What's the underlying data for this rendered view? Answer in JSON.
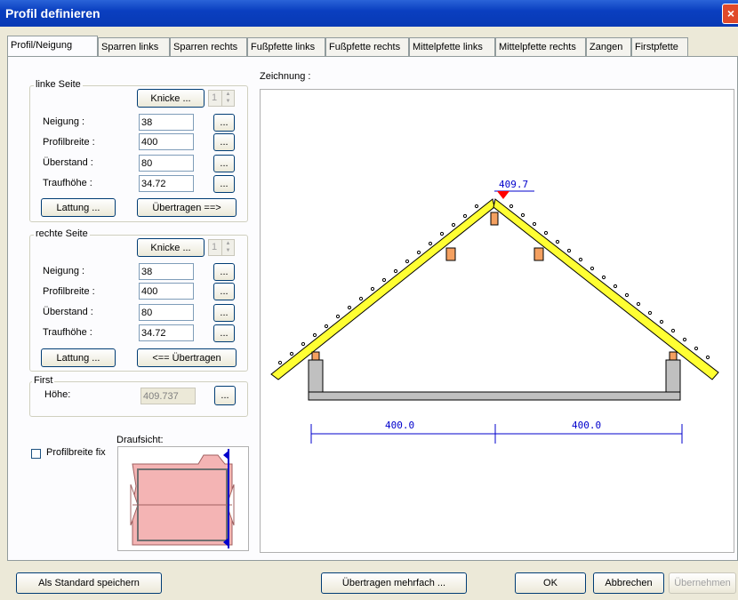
{
  "window": {
    "title": "Profil definieren",
    "close": "×"
  },
  "tabs": [
    "Profil/Neigung",
    "Sparren links",
    "Sparren rechts",
    "Fußpfette links",
    "Fußpfette rechts",
    "Mittelpfette links",
    "Mittelpfette rechts",
    "Zangen",
    "Firstpfette"
  ],
  "left_side": {
    "legend": "linke Seite",
    "knicke": "Knicke ...",
    "knicke_count": "1",
    "fields": [
      {
        "label": "Neigung :",
        "value": "38"
      },
      {
        "label": "Profilbreite :",
        "value": "400"
      },
      {
        "label": "Überstand :",
        "value": "80"
      },
      {
        "label": "Traufhöhe :",
        "value": "34.72"
      }
    ],
    "lattung": "Lattung ...",
    "transfer": "Übertragen ==>"
  },
  "right_side": {
    "legend": "rechte Seite",
    "knicke": "Knicke ...",
    "knicke_count": "1",
    "fields": [
      {
        "label": "Neigung :",
        "value": "38"
      },
      {
        "label": "Profilbreite :",
        "value": "400"
      },
      {
        "label": "Überstand :",
        "value": "80"
      },
      {
        "label": "Traufhöhe :",
        "value": "34.72"
      }
    ],
    "lattung": "Lattung ...",
    "transfer": "<== Übertragen"
  },
  "ellipsis": "...",
  "first": {
    "legend": "First",
    "label": "Höhe:",
    "value": "409.737"
  },
  "profilbreite_fix": "Profilbreite fix",
  "draufsicht": "Draufsicht:",
  "drawing": {
    "label": "Zeichnung :",
    "ridge_height": "409.7",
    "dim_left": "400.0",
    "dim_right": "400.0"
  },
  "footer": {
    "save_default": "Als Standard speichern",
    "transfer_multi": "Übertragen mehrfach ...",
    "ok": "OK",
    "cancel": "Abbrechen",
    "apply": "Übernehmen"
  },
  "colors": {
    "rafter": "#ffff33",
    "purlin": "#f4a060",
    "dimension": "#0000cc",
    "ridge_marker": "#ff0000",
    "plan_fill": "#f4b4b4"
  }
}
